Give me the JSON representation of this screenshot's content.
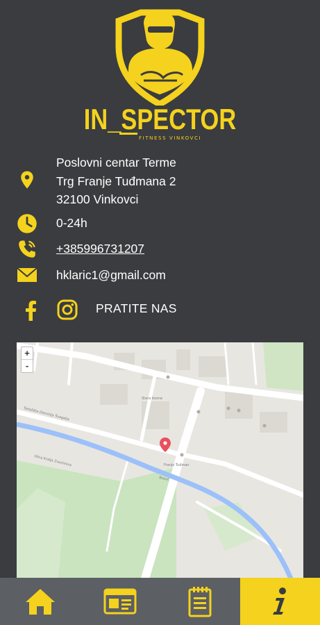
{
  "brand": {
    "name": "IN_SPECTOR",
    "tagline": "FITNESS VINKOVCI",
    "accent_color": "#f4d21e",
    "background_color": "#3a3c3f"
  },
  "contact": {
    "address_line1": "Poslovni centar Terme",
    "address_line2": "Trg Franje Tuđmana 2",
    "address_line3": "32100 Vinkovci",
    "hours": "0-24h",
    "phone": "+385996731207",
    "email": "hklaric1@gmail.com",
    "icons": [
      "location-pin-icon",
      "clock-icon",
      "phone-icon",
      "envelope-icon"
    ]
  },
  "social": {
    "label": "PRATITE NAS",
    "icons": [
      "facebook-icon",
      "instagram-icon"
    ]
  },
  "map": {
    "zoom_in": "+",
    "zoom_out": "-",
    "labels": {
      "street_kolodvorska": "Šetalište Dionizija Švagelja",
      "street_zvonimira": "Ulica Kralja Zvonimira",
      "bosut": "Bosut",
      "square": "Franjo Tuđman",
      "oblog": "Stara bosna"
    }
  },
  "tabbar": {
    "tabs": [
      {
        "name": "home",
        "icon": "home-icon",
        "active": false
      },
      {
        "name": "membership",
        "icon": "id-card-icon",
        "active": false
      },
      {
        "name": "schedule",
        "icon": "clipboard-icon",
        "active": false
      },
      {
        "name": "info",
        "icon": "info-icon",
        "active": true
      }
    ]
  }
}
